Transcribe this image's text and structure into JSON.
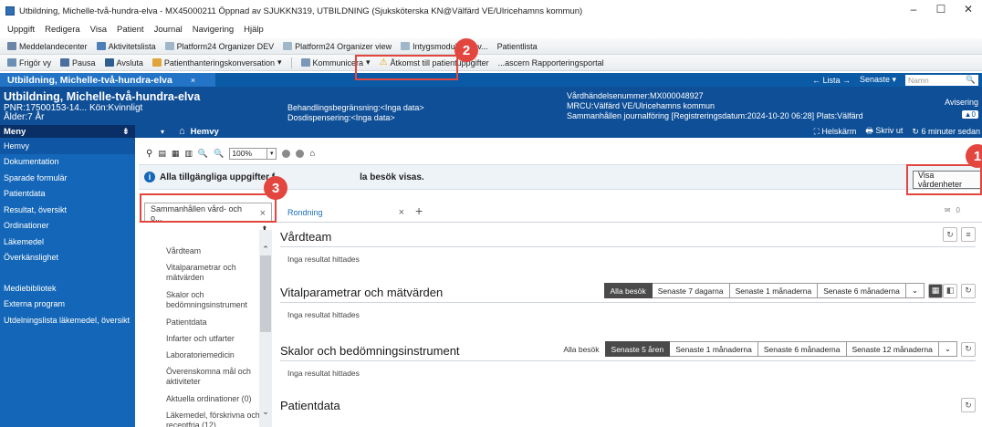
{
  "window": {
    "title": "Utbildning, Michelle-två-hundra-elva - MX45000211 Öppnad av SJUKKN319, UTBILDNING (Sjuksköterska KN@Välfärd VE/Ulricehamns kommun)",
    "min": "–",
    "max": "☐",
    "close": "✕"
  },
  "menu": [
    "Uppgift",
    "Redigera",
    "Visa",
    "Patient",
    "Journal",
    "Navigering",
    "Hjälp"
  ],
  "toolbar1": [
    "Meddelandecenter",
    "Aktivitetslista",
    "Platform24 Organizer DEV",
    "Platform24 Organizer view",
    "Intygsmodulen bev...",
    "Patientlista"
  ],
  "toolbar2": [
    "Frigör vy",
    "Pausa",
    "Avsluta",
    "Patienthanteringskonversation",
    "Kommunicera",
    "Åtkomst till patientuppgifter",
    "...ascern Rapporteringsportal"
  ],
  "patient_tab": {
    "name": "Utbildning, Michelle-två-hundra-elva",
    "close": "×"
  },
  "patbar_right": {
    "lista": "← Lista →",
    "senaste": "Senaste ▾",
    "name_placeholder": "Namn",
    "search": "🔍"
  },
  "header": {
    "name": "Utbildning, Michelle-två-hundra-elva",
    "pnr": "PNR:17500153-14... Kön:Kvinnligt",
    "age": "Ålder:7 År",
    "behandling": "Behandlingsbegränsning:<Inga data>",
    "dosdisp": "Dosdispensering:<Inga data>",
    "vardhandelse": "Vårdhändelsenummer:MX000048927",
    "mrcu": "MRCU:Välfärd VE/Ulricehamns kommun",
    "sammanhallen": "Sammanhållen journalföring [Registreringsdatum:2024-10-20 06:28] Plats:Välfärd",
    "avisering": "Avisering",
    "av_badge": "▲0"
  },
  "sidebar": {
    "heading": "Meny",
    "pin": "⇟",
    "items": [
      "Hemvy",
      "Dokumentation",
      "Sparade formulär",
      "Patientdata",
      "Resultat, översikt",
      "Ordinationer",
      "Läkemedel",
      "Överkänslighet"
    ],
    "items2": [
      "Mediebibliotek",
      "Externa program",
      "Utdelningslista läkemedel, översikt"
    ]
  },
  "navbar": {
    "home": "Hemvy",
    "helskarm": "Helskärm",
    "skrivut": "Skriv ut",
    "updated": "6 minuter sedan"
  },
  "zoom": "100%",
  "info": {
    "text": "Alla tillgängliga uppgifter f",
    "text2": "la besök visas.",
    "button": "Visa vårdenheter"
  },
  "tabs": {
    "t1": "Sammanhållen vård- och o...",
    "t2": "Rondning",
    "close": "×",
    "add": "+",
    "right_count": "0"
  },
  "leftnav": [
    "Vårdteam",
    "Vitalparametrar och mätvärden",
    "Skalor och bedömningsinstrument",
    "Patientdata",
    "Infarter och utfarter",
    "Laboratoriemedicin",
    "Överenskomna mål och aktiviteter",
    "Aktuella ordinationer (0)",
    "Läkemedel, förskrivna och receptfria (12)"
  ],
  "sections": {
    "vardteam": {
      "title": "Vårdteam",
      "nores": "Inga resultat hittades"
    },
    "vital": {
      "title": "Vitalparametrar och mätvärden",
      "nores": "Inga resultat hittades",
      "filters": [
        "Alla besök",
        "Senaste 7 dagarna",
        "Senaste 1 månaderna",
        "Senaste 6 månaderna"
      ]
    },
    "skalor": {
      "title": "Skalor och bedömningsinstrument",
      "nores": "Inga resultat hittades",
      "label": "Alla besök",
      "filters": [
        "Senaste 5 åren",
        "Senaste 1 månaderna",
        "Senaste 6 månaderna",
        "Senaste 12 månaderna"
      ]
    },
    "patientdata": {
      "title": "Patientdata"
    }
  },
  "callouts": [
    "1",
    "2",
    "3"
  ],
  "colors": {
    "callout": "#e2463f",
    "header_blue": "#0f4f97",
    "sidebar_blue": "#1467b8"
  }
}
